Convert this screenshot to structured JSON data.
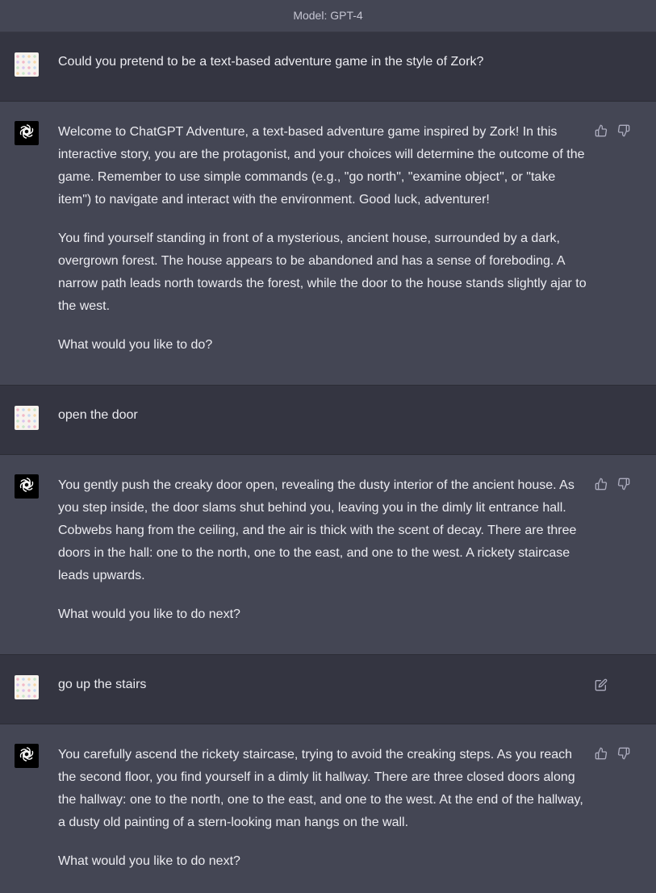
{
  "header": {
    "model_label": "Model: GPT-4"
  },
  "messages": [
    {
      "role": "user",
      "text": "Could you pretend to be a text-based adventure game in the style of Zork?"
    },
    {
      "role": "assistant",
      "paragraphs": [
        "Welcome to ChatGPT Adventure, a text-based adventure game inspired by Zork! In this interactive story, you are the protagonist, and your choices will determine the outcome of the game. Remember to use simple commands (e.g., \"go north\", \"examine object\", or \"take item\") to navigate and interact with the environment. Good luck, adventurer!",
        "You find yourself standing in front of a mysterious, ancient house, surrounded by a dark, overgrown forest. The house appears to be abandoned and has a sense of foreboding. A narrow path leads north towards the forest, while the door to the house stands slightly ajar to the west.",
        "What would you like to do?"
      ]
    },
    {
      "role": "user",
      "text": "open the door"
    },
    {
      "role": "assistant",
      "paragraphs": [
        "You gently push the creaky door open, revealing the dusty interior of the ancient house. As you step inside, the door slams shut behind you, leaving you in the dimly lit entrance hall. Cobwebs hang from the ceiling, and the air is thick with the scent of decay. There are three doors in the hall: one to the north, one to the east, and one to the west. A rickety staircase leads upwards.",
        "What would you like to do next?"
      ]
    },
    {
      "role": "user",
      "text": "go up the stairs"
    },
    {
      "role": "assistant",
      "paragraphs": [
        "You carefully ascend the rickety staircase, trying to avoid the creaking steps. As you reach the second floor, you find yourself in a dimly lit hallway. There are three closed doors along the hallway: one to the north, one to the east, and one to the west. At the end of the hallway, a dusty old painting of a stern-looking man hangs on the wall.",
        "What would you like to do next?"
      ]
    }
  ],
  "icons": {
    "like": "thumbs-up-icon",
    "dislike": "thumbs-down-icon",
    "edit": "edit-icon",
    "assistant_avatar": "openai-logo-icon"
  },
  "colors": {
    "user_bg": "#343541",
    "assistant_bg": "#444654",
    "text": "#ececf1",
    "icon": "#acacbe"
  }
}
